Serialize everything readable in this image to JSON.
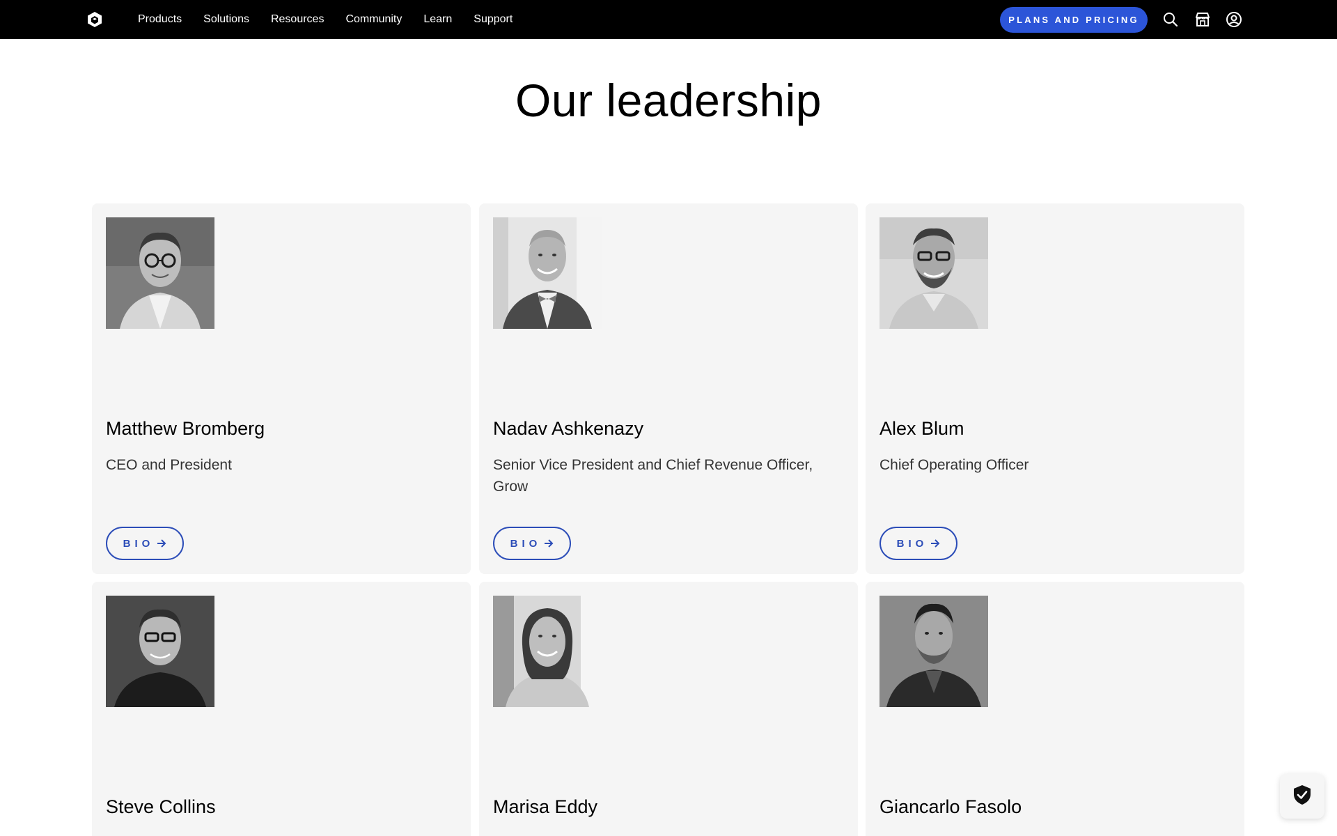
{
  "nav": {
    "logo_icon": "unity-cube-icon",
    "items": [
      {
        "label": "Products"
      },
      {
        "label": "Solutions"
      },
      {
        "label": "Resources"
      },
      {
        "label": "Community"
      },
      {
        "label": "Learn"
      },
      {
        "label": "Support"
      }
    ],
    "cta_label": "PLANS AND PRICING",
    "cta_color": "#2c55d8",
    "icons": [
      "search-icon",
      "store-icon",
      "account-icon"
    ]
  },
  "page": {
    "title": "Our leadership"
  },
  "leaders": [
    {
      "name": "Matthew Bromberg",
      "role": "CEO and President",
      "button": "BIO"
    },
    {
      "name": "Nadav Ashkenazy",
      "role": "Senior Vice President and Chief Revenue Officer, Grow",
      "button": "BIO"
    },
    {
      "name": "Alex Blum",
      "role": "Chief Operating Officer",
      "button": "BIO"
    },
    {
      "name": "Steve Collins",
      "role": "",
      "button": ""
    },
    {
      "name": "Marisa Eddy",
      "role": "",
      "button": ""
    },
    {
      "name": "Giancarlo Fasolo",
      "role": "",
      "button": ""
    }
  ],
  "colors": {
    "topbar": "#000000",
    "card_bg": "#f5f5f5",
    "bio_accent": "#2c4db8"
  },
  "floating": {
    "icon": "shield-check-icon"
  }
}
